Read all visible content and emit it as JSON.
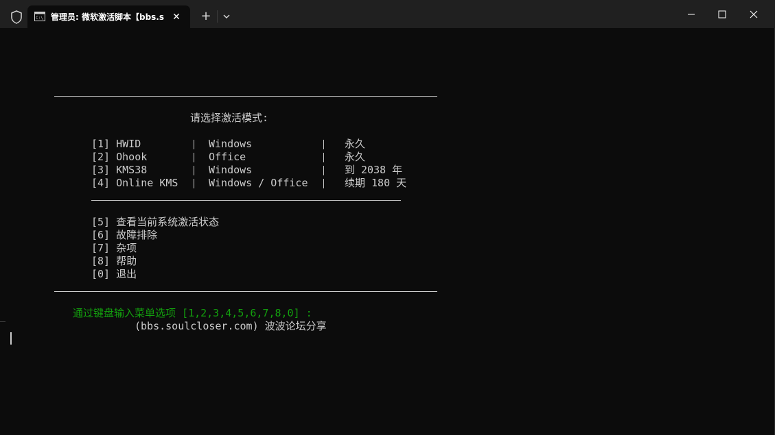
{
  "window": {
    "tab_title": "管理员:  微软激活脚本【bbs.s",
    "icons": {
      "shield": "shield-icon",
      "tab": "terminal-icon",
      "close_tab": "close-icon",
      "new_tab": "plus-icon",
      "dropdown": "chevron-down-icon",
      "minimize": "minimize-icon",
      "maximize": "maximize-icon",
      "close": "close-icon"
    },
    "tab_close_glyph": "✕",
    "new_tab_glyph": "+"
  },
  "terminal": {
    "header": "请选择激活模式:",
    "activation_options": [
      {
        "key": "[1] HWID",
        "target": "Windows",
        "duration": "永久"
      },
      {
        "key": "[2] Ohook",
        "target": "Office",
        "duration": "永久"
      },
      {
        "key": "[3] KMS38",
        "target": "Windows",
        "duration": "到 2038 年"
      },
      {
        "key": "[4] Online KMS",
        "target": "Windows / Office",
        "duration": "续期 180 天"
      }
    ],
    "other_options": [
      "[5] 查看当前系统激活状态",
      "[6] 故障排除",
      "[7] 杂项",
      "[8] 帮助",
      "[0] 退出"
    ],
    "prompt": "通过键盘输入菜单选项 [1,2,3,4,5,6,7,8,0] :",
    "credit": "(bbs.soulcloser.com) 波波论坛分享"
  },
  "colors": {
    "background": "#0c0c0c",
    "text": "#cccccc",
    "prompt_green": "#13a10e",
    "titlebar": "#202020"
  }
}
